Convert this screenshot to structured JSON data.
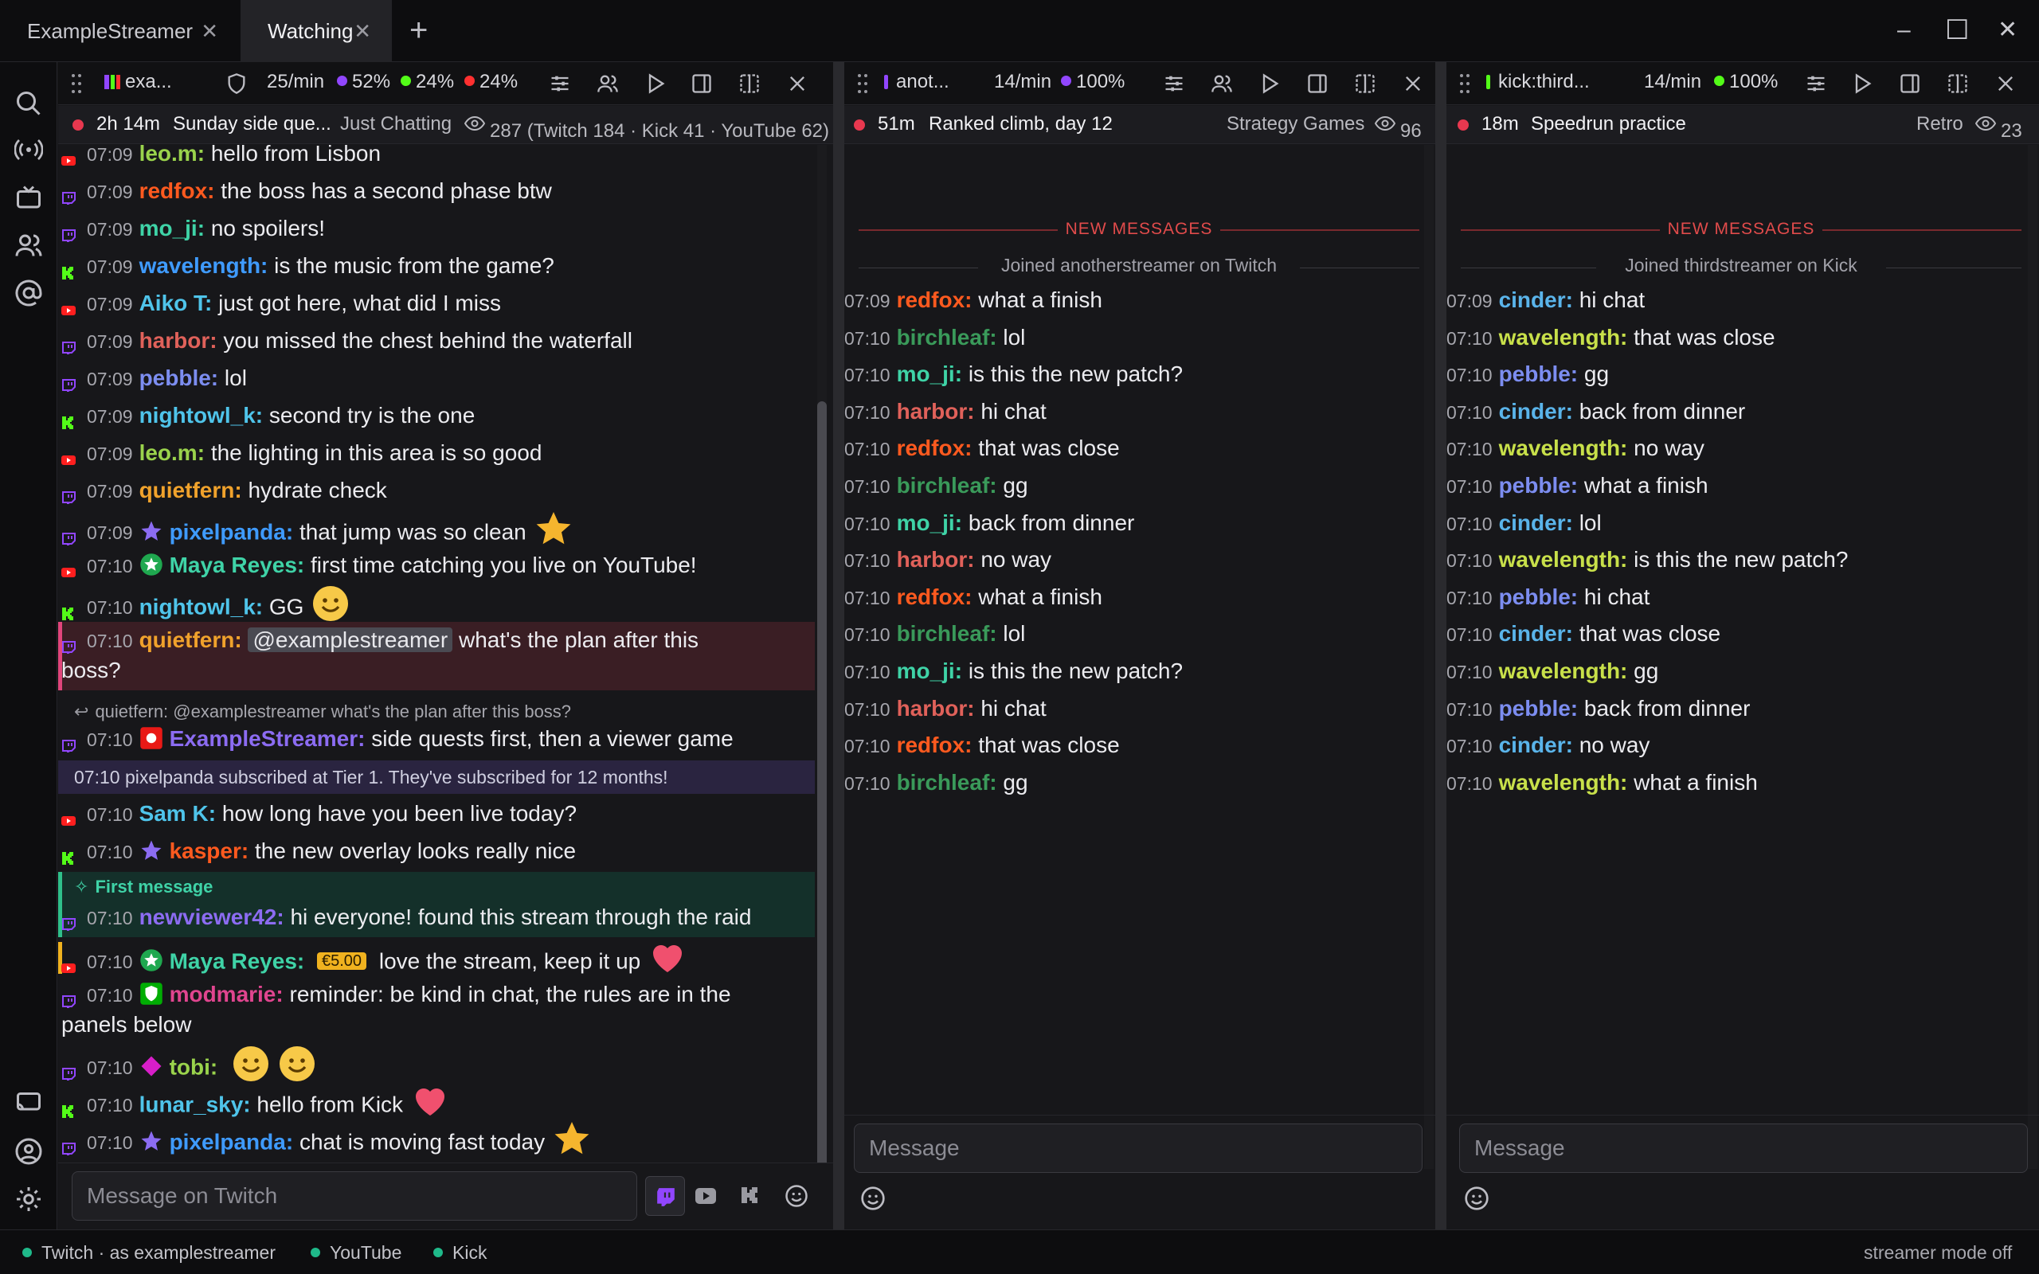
{
  "tabs": [
    {
      "label": "ExampleStreamer",
      "active": false
    },
    {
      "label": "Watching",
      "active": true
    }
  ],
  "window": {
    "minimize": "–",
    "maximize": "☐",
    "close": "✕"
  },
  "panels": [
    {
      "header": {
        "channel": "exa...",
        "rate": "25/min",
        "stats": [
          "52%",
          "24%",
          "24%"
        ]
      },
      "live": {
        "uptime": "2h 14m",
        "title": "Sunday side que...",
        "category": "Just Chatting",
        "viewers": "287 (Twitch 184 · Kick 41 · YouTube 62)"
      },
      "messages": [
        {
          "p": "youtube",
          "t": "07:09",
          "u": "leo.m:",
          "c": "#9ad34c",
          "m": "hello from Lisbon"
        },
        {
          "p": "twitch",
          "t": "07:09",
          "u": "redfox:",
          "c": "#ff5a1f",
          "m": "the boss has a second phase btw"
        },
        {
          "p": "twitch",
          "t": "07:09",
          "u": "mo_ji:",
          "c": "#3fd3a7",
          "m": "no spoilers!"
        },
        {
          "p": "kick",
          "t": "07:09",
          "u": "wavelength:",
          "c": "#3f9bff",
          "m": "is the music from the game?"
        },
        {
          "p": "youtube",
          "t": "07:09",
          "u": "Aiko T:",
          "c": "#4fc4ea",
          "m": "just got here, what did I miss"
        },
        {
          "p": "twitch",
          "t": "07:09",
          "u": "harbor:",
          "c": "#e0615a",
          "m": "you missed the chest behind the waterfall"
        },
        {
          "p": "twitch",
          "t": "07:09",
          "u": "pebble:",
          "c": "#7c8df0",
          "m": "lol"
        },
        {
          "p": "kick",
          "t": "07:09",
          "u": "nightowl_k:",
          "c": "#4fc4ea",
          "m": "second try is the one"
        },
        {
          "p": "youtube",
          "t": "07:09",
          "u": "leo.m:",
          "c": "#9ad34c",
          "m": "the lighting in this area is so good"
        },
        {
          "p": "twitch",
          "t": "07:09",
          "u": "quietfern:",
          "c": "#f0a22c",
          "m": "hydrate check"
        },
        {
          "p": "twitch",
          "t": "07:09",
          "u": "pixelpanda:",
          "c": "#3f9bff",
          "m": "that jump was so clean",
          "badge": "star",
          "emote": "star"
        },
        {
          "p": "youtube",
          "t": "07:10",
          "u": "Maya Reyes:",
          "c": "#3fd3a7",
          "m": "first time catching you live on YouTube!",
          "badge": "member"
        },
        {
          "p": "kick",
          "t": "07:10",
          "u": "nightowl_k:",
          "c": "#4fc4ea",
          "m": "GG",
          "emote": "smile"
        }
      ],
      "mention": {
        "t": "07:10",
        "u": "quietfern:",
        "tag": "@examplestreamer",
        "m1": "what's the plan after this",
        "m2": "boss?"
      },
      "reply": {
        "context": "quietfern: @examplestreamer what's the plan after this boss?",
        "t": "07:10",
        "u": "ExampleStreamer:",
        "m": "side quests first, then a viewer game"
      },
      "sub": "07:10  pixelpanda subscribed at Tier 1. They've subscribed for 12 months!",
      "messages2": [
        {
          "p": "youtube",
          "t": "07:10",
          "u": "Sam K:",
          "c": "#4fc4ea",
          "m": "how long have you been live today?"
        },
        {
          "p": "kick",
          "t": "07:10",
          "u": "kasper:",
          "c": "#ff5a1f",
          "m": "the new overlay looks really nice",
          "badge": "star"
        }
      ],
      "first": {
        "label": "First message",
        "t": "07:10",
        "u": "newviewer42:",
        "m": "hi everyone! found this stream through the raid"
      },
      "superchat": {
        "t": "07:10",
        "u": "Maya Reyes:",
        "amount": "€5.00",
        "m": "love the stream, keep it up"
      },
      "mod": {
        "t": "07:10",
        "u": "modmarie:",
        "m1": "reminder: be kind in chat, the rules are in the",
        "m2": "panels below"
      },
      "messages3": [
        {
          "p": "twitch",
          "t": "07:10",
          "u": "tobi:",
          "c": "#9ad34c",
          "m": "",
          "badge": "diamond",
          "emote": "smile2"
        },
        {
          "p": "kick",
          "t": "07:10",
          "u": "lunar_sky:",
          "c": "#4fc4ea",
          "m": "hello from Kick",
          "emote": "heart"
        },
        {
          "p": "twitch",
          "t": "07:10",
          "u": "pixelpanda:",
          "c": "#3f9bff",
          "m": "chat is moving fast today",
          "badge": "star",
          "emote": "star"
        }
      ],
      "composer": "Message on Twitch"
    },
    {
      "header": {
        "channel": "anot...",
        "rate": "14/min",
        "stats": [
          "100%"
        ]
      },
      "live": {
        "uptime": "51m",
        "title": "Ranked climb, day 12",
        "category": "Strategy Games",
        "viewers": "96"
      },
      "new_label": "NEW MESSAGES",
      "joined": "Joined anotherstreamer on Twitch",
      "messages": [
        {
          "t": "07:09",
          "u": "redfox:",
          "c": "#ff5a1f",
          "m": "what a finish"
        },
        {
          "t": "07:10",
          "u": "birchleaf:",
          "c": "#3a9a5a",
          "m": "lol"
        },
        {
          "t": "07:10",
          "u": "mo_ji:",
          "c": "#3fd3a7",
          "m": "is this the new patch?"
        },
        {
          "t": "07:10",
          "u": "harbor:",
          "c": "#e0615a",
          "m": "hi chat"
        },
        {
          "t": "07:10",
          "u": "redfox:",
          "c": "#ff5a1f",
          "m": "that was close"
        },
        {
          "t": "07:10",
          "u": "birchleaf:",
          "c": "#3a9a5a",
          "m": "gg"
        },
        {
          "t": "07:10",
          "u": "mo_ji:",
          "c": "#3fd3a7",
          "m": "back from dinner"
        },
        {
          "t": "07:10",
          "u": "harbor:",
          "c": "#e0615a",
          "m": "no way"
        },
        {
          "t": "07:10",
          "u": "redfox:",
          "c": "#ff5a1f",
          "m": "what a finish"
        },
        {
          "t": "07:10",
          "u": "birchleaf:",
          "c": "#3a9a5a",
          "m": "lol"
        },
        {
          "t": "07:10",
          "u": "mo_ji:",
          "c": "#3fd3a7",
          "m": "is this the new patch?"
        },
        {
          "t": "07:10",
          "u": "harbor:",
          "c": "#e0615a",
          "m": "hi chat"
        },
        {
          "t": "07:10",
          "u": "redfox:",
          "c": "#ff5a1f",
          "m": "that was close"
        },
        {
          "t": "07:10",
          "u": "birchleaf:",
          "c": "#3a9a5a",
          "m": "gg"
        }
      ],
      "composer": "Message"
    },
    {
      "header": {
        "channel": "kick:third...",
        "rate": "14/min",
        "stats": [
          "100%"
        ]
      },
      "live": {
        "uptime": "18m",
        "title": "Speedrun practice",
        "category": "Retro",
        "viewers": "23"
      },
      "new_label": "NEW MESSAGES",
      "joined": "Joined thirdstreamer on Kick",
      "messages": [
        {
          "t": "07:09",
          "u": "cinder:",
          "c": "#5ab4ea",
          "m": "hi chat"
        },
        {
          "t": "07:10",
          "u": "wavelength:",
          "c": "#c8e04a",
          "m": "that was close"
        },
        {
          "t": "07:10",
          "u": "pebble:",
          "c": "#7c8df0",
          "m": "gg"
        },
        {
          "t": "07:10",
          "u": "cinder:",
          "c": "#5ab4ea",
          "m": "back from dinner"
        },
        {
          "t": "07:10",
          "u": "wavelength:",
          "c": "#c8e04a",
          "m": "no way"
        },
        {
          "t": "07:10",
          "u": "pebble:",
          "c": "#7c8df0",
          "m": "what a finish"
        },
        {
          "t": "07:10",
          "u": "cinder:",
          "c": "#5ab4ea",
          "m": "lol"
        },
        {
          "t": "07:10",
          "u": "wavelength:",
          "c": "#c8e04a",
          "m": "is this the new patch?"
        },
        {
          "t": "07:10",
          "u": "pebble:",
          "c": "#7c8df0",
          "m": "hi chat"
        },
        {
          "t": "07:10",
          "u": "cinder:",
          "c": "#5ab4ea",
          "m": "that was close"
        },
        {
          "t": "07:10",
          "u": "wavelength:",
          "c": "#c8e04a",
          "m": "gg"
        },
        {
          "t": "07:10",
          "u": "pebble:",
          "c": "#7c8df0",
          "m": "back from dinner"
        },
        {
          "t": "07:10",
          "u": "cinder:",
          "c": "#5ab4ea",
          "m": "no way"
        },
        {
          "t": "07:10",
          "u": "wavelength:",
          "c": "#c8e04a",
          "m": "what a finish"
        }
      ],
      "composer": "Message"
    }
  ],
  "status": {
    "twitch": "Twitch · as examplestreamer",
    "youtube": "YouTube",
    "kick": "Kick",
    "mode": "streamer mode off"
  }
}
